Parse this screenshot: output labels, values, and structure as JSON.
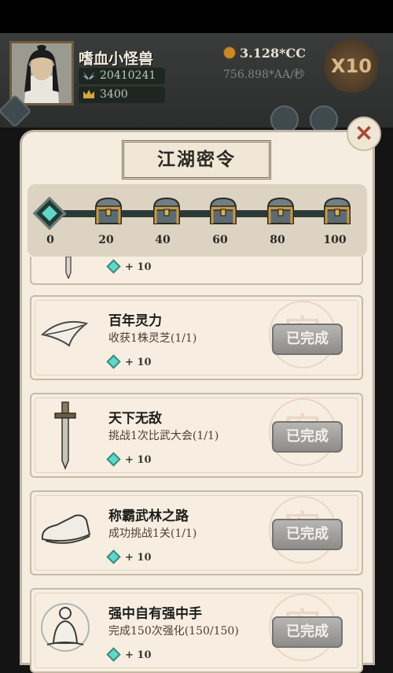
{
  "hud": {
    "player_name": "嗜血小怪兽",
    "power_value": "20410241",
    "crown_value": "3400",
    "gold": "3.128*CC",
    "gold_rate": "756.898*AA/秒",
    "multiplier": "X10"
  },
  "panel": {
    "title": "江湖密令",
    "progress": {
      "current": 0,
      "max": 100,
      "fill_fraction": 0.05,
      "milestones": [
        "0",
        "20",
        "40",
        "60",
        "80",
        "100"
      ]
    }
  },
  "partial_task": {
    "reward": "+ 10"
  },
  "tasks": [
    {
      "name": "百年灵力",
      "desc": "收获1株灵芝(1/1)",
      "reward": "+ 10",
      "status": "已完成",
      "icon": "feather-icon"
    },
    {
      "name": "天下无敌",
      "desc": "挑战1次比武大会(1/1)",
      "reward": "+ 10",
      "status": "已完成",
      "icon": "sword-icon"
    },
    {
      "name": "称霸武林之路",
      "desc": "成功挑战1关(1/1)",
      "reward": "+ 10",
      "status": "已完成",
      "icon": "shoe-icon"
    },
    {
      "name": "强中自有强中手",
      "desc": "完成150次强化(150/150)",
      "reward": "+ 10",
      "status": "已完成",
      "icon": "meditation-icon"
    }
  ],
  "colors": {
    "panel_bg": "#f5ede0",
    "track_fill": "#2fb5a0",
    "done_button": "#a3a19d",
    "gem": "#62d6c7"
  }
}
